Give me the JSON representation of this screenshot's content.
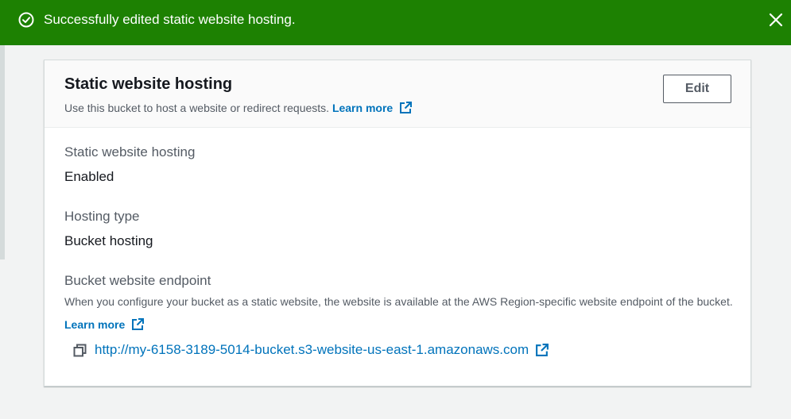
{
  "flash": {
    "message": "Successfully edited static website hosting.",
    "color": "#1d8102",
    "status_icon": "check-circle-icon",
    "dismiss_icon": "close-icon"
  },
  "card": {
    "title": "Static website hosting",
    "description": "Use this bucket to host a website or redirect requests.",
    "learn_more": "Learn more",
    "edit_label": "Edit",
    "fields": {
      "hosting": {
        "label": "Static website hosting",
        "value": "Enabled"
      },
      "type": {
        "label": "Hosting type",
        "value": "Bucket hosting"
      },
      "endpoint": {
        "label": "Bucket website endpoint",
        "description": "When you configure your bucket as a static website, the website is available at the AWS Region-specific website endpoint of the bucket.",
        "learn_more": "Learn more",
        "url": "http://my-6158-3189-5014-bucket.s3-website-us-east-1.amazonaws.com"
      }
    }
  },
  "colors": {
    "link": "#0073bb",
    "text": "#16191f",
    "secondary": "#545b64"
  }
}
